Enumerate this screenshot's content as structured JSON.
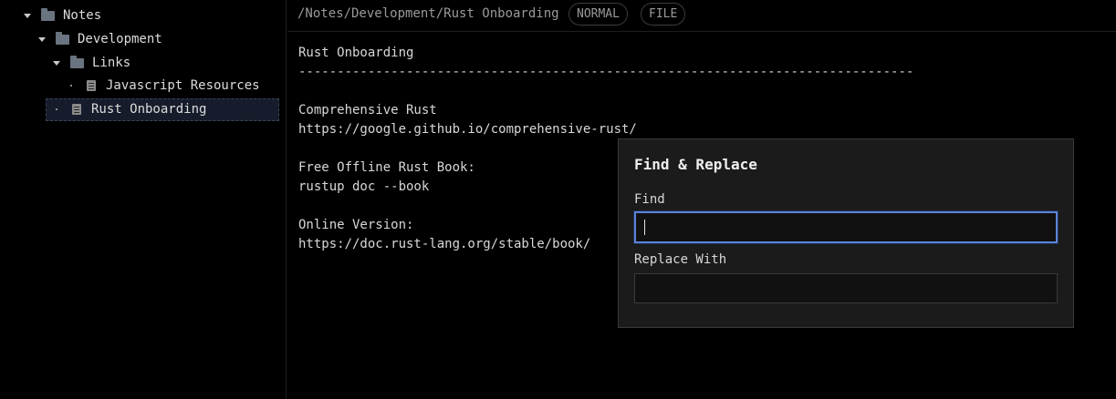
{
  "sidebar": {
    "tree": [
      {
        "label": "Notes",
        "type": "folder",
        "expanded": true
      },
      {
        "label": "Development",
        "type": "folder",
        "expanded": true
      },
      {
        "label": "Links",
        "type": "folder",
        "expanded": true
      },
      {
        "label": "Javascript Resources",
        "type": "file"
      },
      {
        "label": "Rust Onboarding",
        "type": "file",
        "selected": true
      }
    ]
  },
  "topbar": {
    "path": "/Notes/Development/Rust Onboarding",
    "mode": "NORMAL",
    "kind": "FILE"
  },
  "editor": {
    "lines": [
      "Rust Onboarding",
      "--------------------------------------------------------------------------------",
      "",
      "Comprehensive Rust",
      "https://google.github.io/comprehensive-rust/",
      "",
      "Free Offline Rust Book:",
      "rustup doc --book",
      "",
      "Online Version:",
      "https://doc.rust-lang.org/stable/book/"
    ]
  },
  "find_replace": {
    "title": "Find & Replace",
    "find_label": "Find",
    "find_value": "",
    "replace_label": "Replace With",
    "replace_value": ""
  },
  "colors": {
    "background": "#000000",
    "focus_border": "#5a84d8",
    "selection": "#161c2b"
  },
  "icons": {
    "folder": "folder-icon",
    "file": "file-icon",
    "expand": "chevron-down-icon"
  }
}
